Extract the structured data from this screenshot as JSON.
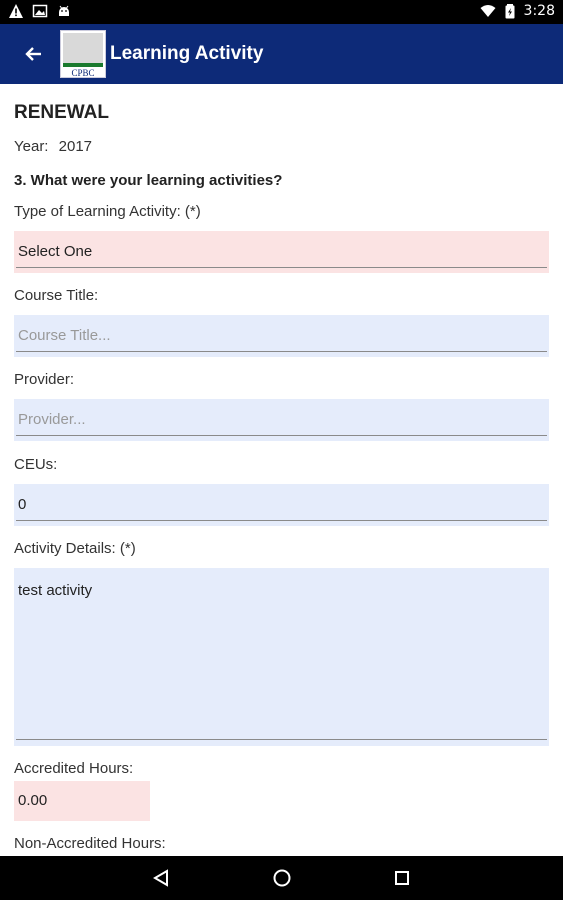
{
  "status_bar": {
    "time": "3:28",
    "icons": [
      "warning-icon",
      "image-icon",
      "android-icon",
      "wifi-icon",
      "battery-icon"
    ]
  },
  "app_bar": {
    "title": "Learning Activity",
    "logo_text": "CPBC",
    "background": "#0d2a78"
  },
  "form": {
    "heading": "RENEWAL",
    "year_label": "Year:",
    "year_value": "2017",
    "question": "3. What were your learning activities?",
    "type_label": "Type of Learning Activity: (*)",
    "type_value": "Select One",
    "course_label": "Course Title:",
    "course_placeholder": "Course Title...",
    "provider_label": "Provider:",
    "provider_placeholder": "Provider...",
    "ceus_label": "CEUs:",
    "ceus_value": "0",
    "details_label": "Activity Details: (*)",
    "details_value": "test activity",
    "accredited_label": "Accredited Hours:",
    "accredited_value": "0.00",
    "non_accredited_label": "Non-Accredited Hours:"
  },
  "colors": {
    "required_field": "#fbe3e3",
    "optional_field": "#e5ecfb"
  },
  "nav_bar": {
    "icons": [
      "back-triangle-icon",
      "home-circle-icon",
      "recents-square-icon"
    ]
  }
}
